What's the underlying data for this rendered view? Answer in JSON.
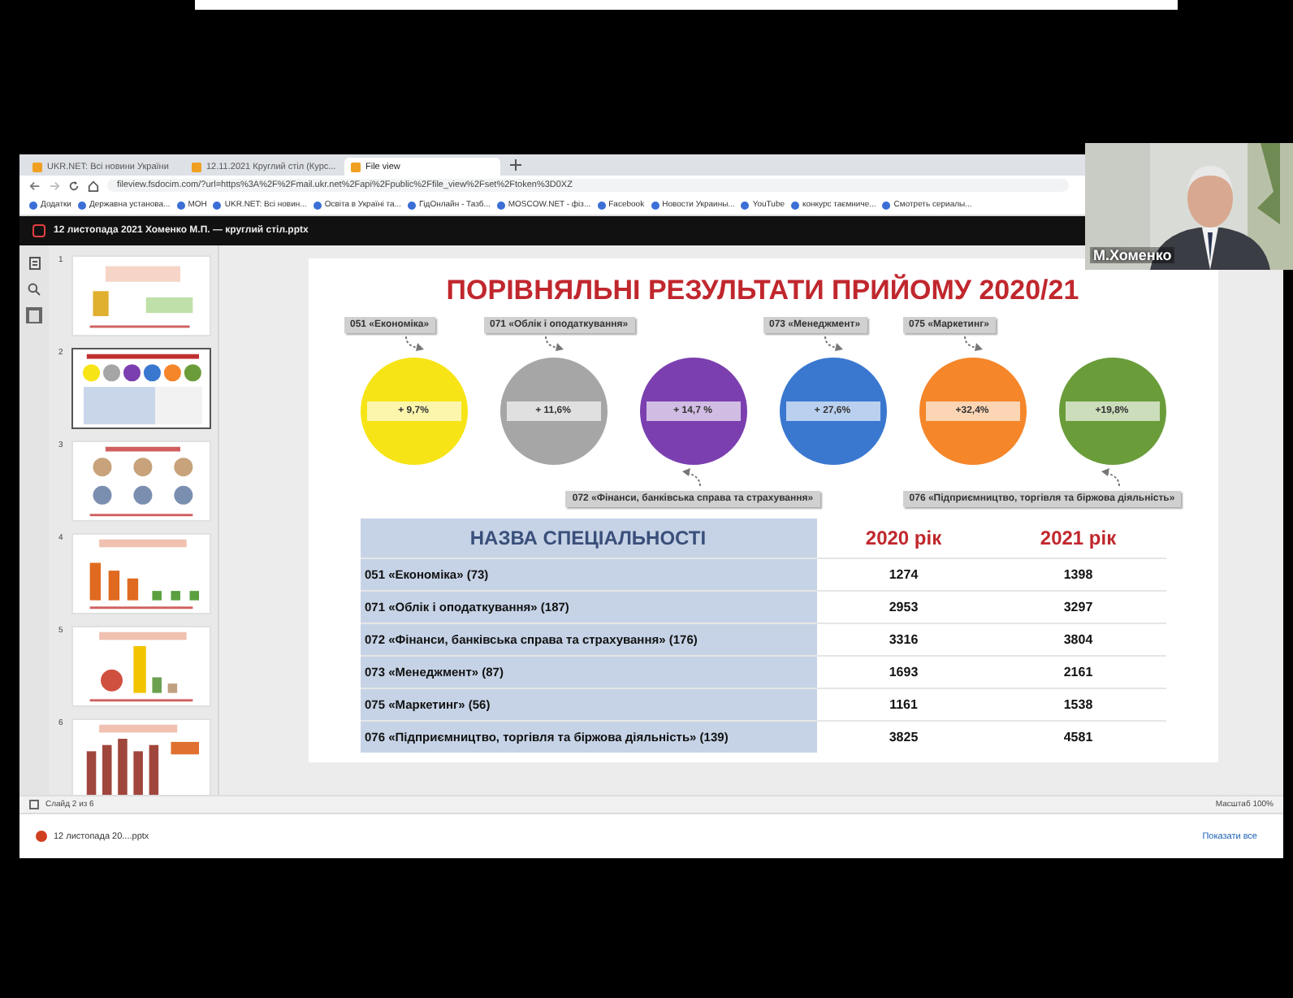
{
  "browser": {
    "tabs": [
      {
        "title": "UKR.NET: Всі новини України",
        "selected": false
      },
      {
        "title": "12.11.2021 Круглий стіл (Курс...",
        "selected": false
      },
      {
        "title": "File view",
        "selected": true
      }
    ],
    "url": "fileview.fsdocim.com/?url=https%3A%2F%2Fmail.ukr.net%2Fapi%2Fpublic%2Ffile_view%2Fset%2Ftoken%3D0XZ",
    "bookmarks": [
      "Додатки",
      "Державна установа...",
      "МОН",
      "UKR.NET: Всі новин...",
      "Освіта в Україні та...",
      "ГідОнлайн - Тазб...",
      "MOSCOW.NET - фіз...",
      "Facebook",
      "Новости Украины...",
      "YouTube",
      "конкурс таємниче...",
      "Смотреть сериалы..."
    ]
  },
  "document_title": "12 листопада 2021 Хоменко М.П. — круглий стіл.pptx",
  "sidebar_tools": [
    {
      "kind": "panel",
      "selected": false
    },
    {
      "kind": "search",
      "selected": false
    },
    {
      "kind": "thumbnails",
      "selected": true
    }
  ],
  "thumbnails": [
    {
      "number": "1",
      "selected": false
    },
    {
      "number": "2",
      "selected": true
    },
    {
      "number": "3",
      "selected": false
    },
    {
      "number": "4",
      "selected": false
    },
    {
      "number": "5",
      "selected": false
    },
    {
      "number": "6",
      "selected": false
    }
  ],
  "slide": {
    "title": "ПОРІВНЯЛЬНІ РЕЗУЛЬТАТИ ПРИЙОМУ 2020/21",
    "circles": [
      {
        "label": "051 «Економіка»",
        "kind": "above",
        "value": "+ 9,7%",
        "color": "#f7e416"
      },
      {
        "label": "071 «Облік і оподаткування»",
        "kind": "above",
        "value": "+ 11,6%",
        "color": "#a6a6a6"
      },
      {
        "label": "072 «Фінанси, банківська справа та страхування»",
        "kind": "below",
        "value": "+ 14,7 %",
        "color": "#7b3fb0"
      },
      {
        "label": "073 «Менеджмент»",
        "kind": "above",
        "value": "+ 27,6%",
        "color": "#3a78d0"
      },
      {
        "label": "075 «Маркетинг»",
        "kind": "above",
        "value": "+32,4%",
        "color": "#f5862a"
      },
      {
        "label": "076 «Підприємництво, торгівля та біржова діяльність»",
        "kind": "below",
        "value": "+19,8%",
        "color": "#6a9d3a"
      }
    ],
    "table": {
      "columns": [
        "НАЗВА СПЕЦІАЛЬНОСТІ",
        "2020 рік",
        "2021 рік"
      ],
      "rows": [
        [
          "051 «Економіка» (73)",
          "1274",
          "1398"
        ],
        [
          "071 «Облік і оподаткування» (187)",
          "2953",
          "3297"
        ],
        [
          "072 «Фінанси, банківська справа та страхування» (176)",
          "3316",
          "3804"
        ],
        [
          "073 «Менеджмент» (87)",
          "1693",
          "2161"
        ],
        [
          "075 «Маркетинг» (56)",
          "1161",
          "1538"
        ],
        [
          "076 «Підприємництво, торгівля та біржова діяльність» (139)",
          "3825",
          "4581"
        ]
      ]
    }
  },
  "status_bar": {
    "slide_info": "Слайд 2 из 6",
    "zoom": "Масштаб 100%"
  },
  "downloads": {
    "file": "12 листопада 20....pptx",
    "show_all": "Показати все"
  },
  "webcam": {
    "name": "М.Хоменко"
  }
}
